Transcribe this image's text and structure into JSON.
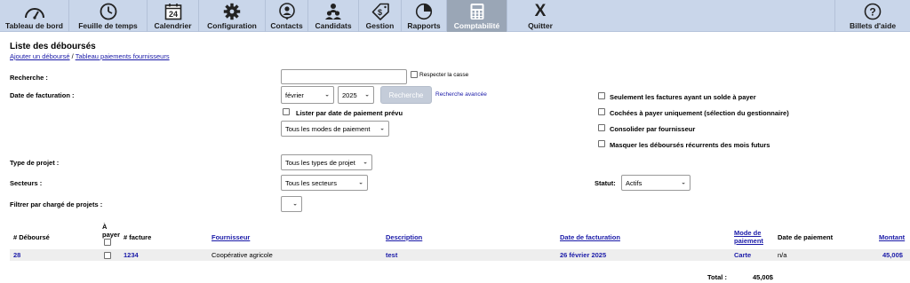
{
  "nav": {
    "items": [
      {
        "label": "Tableau de bord",
        "icon": "dashboard-gauge-icon"
      },
      {
        "label": "Feuille de temps",
        "icon": "clock-icon"
      },
      {
        "label": "Calendrier",
        "icon": "calendar-icon",
        "icon_text": "24"
      },
      {
        "label": "Configuration",
        "icon": "gear-icon"
      },
      {
        "label": "Contacts",
        "icon": "contact-person-icon"
      },
      {
        "label": "Candidats",
        "icon": "users-group-icon"
      },
      {
        "label": "Gestion",
        "icon": "money-tag-icon"
      },
      {
        "label": "Rapports",
        "icon": "pie-chart-icon"
      },
      {
        "label": "Comptabilité",
        "icon": "calculator-icon",
        "active": true
      },
      {
        "label": "Quitter",
        "icon": "close-x-icon",
        "icon_text": "X"
      },
      {
        "label": "Billets d'aide",
        "icon": "help-question-icon",
        "icon_text": "?"
      }
    ]
  },
  "page": {
    "title": "Liste des déboursés",
    "breadcrumb": {
      "add_link": "Ajouter un déboursé",
      "separator": " / ",
      "suppliers_link": "Tableau paiements fournisseurs"
    }
  },
  "filters": {
    "search_label": "Recherche :",
    "search_value": "",
    "case_sensitive_label": "Respecter la casse",
    "date_label": "Date de facturation :",
    "month_value": "février",
    "year_value": "2025",
    "search_button": "Recherche",
    "advanced_search_link": "Recherche avancée",
    "list_by_payment_date_label": "Lister par date de paiement prévu",
    "payment_mode_value": "Tous les modes de paiement",
    "balance_only_label": "Seulement les factures ayant un solde à payer",
    "checked_to_pay_label": "Cochées à payer uniquement (sélection du gestionnaire)",
    "consolidate_label": "Consolider par fournisseur",
    "hide_recurring_label": "Masquer les déboursés récurrents des mois futurs",
    "project_type_label": "Type de projet :",
    "project_type_value": "Tous les types de projet",
    "sectors_label": "Secteurs :",
    "sectors_value": "Tous les secteurs",
    "status_label": "Statut:",
    "status_value": "Actifs",
    "project_manager_label": "Filtrer par chargé de projets :",
    "project_manager_value": ""
  },
  "table": {
    "headers": {
      "number": "# Déboursé",
      "to_pay_1": "À",
      "to_pay_2": "payer",
      "invoice": "# facture",
      "supplier": "Fournisseur",
      "description": "Description",
      "invoice_date": "Date de facturation",
      "payment_mode_1": "Mode de",
      "payment_mode_2": "paiement",
      "payment_date": "Date de paiement",
      "amount": "Montant"
    },
    "rows": [
      {
        "number": "28",
        "invoice": "1234",
        "supplier": "Coopérative agricole",
        "description": "test",
        "invoice_date": "26 février 2025",
        "payment_mode": "Carte",
        "payment_date": "n/a",
        "amount": "45,00$"
      }
    ],
    "total_label": "Total :",
    "total_value": "45,00$"
  }
}
